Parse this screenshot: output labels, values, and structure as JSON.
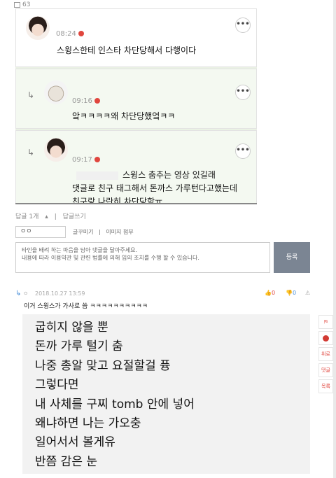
{
  "header": {
    "comment_count": "63"
  },
  "screenshot": {
    "comments": [
      {
        "time": "08:24",
        "text": "스윙스한테 인스타 차단당해서 다행이다",
        "reply": false
      },
      {
        "time": "09:16",
        "text": "앜ㅋㅋㅋㅋ왜 차단당했엌ㅋㅋ",
        "reply": true
      },
      {
        "time": "09:17",
        "text_line1": "스윙스 춤추는 영상 있길래",
        "text_line2": "댓글로 친구 태그해서 돈까스 가루턴다고했는데",
        "text_line3": "친구랑 나란히 차단당함ㅠ",
        "reply": true
      }
    ],
    "more_glyph": "•••"
  },
  "replybar": {
    "reply_count": "답글 1개",
    "write_reply": "답글쓰기"
  },
  "form": {
    "nickname": "ㅇㅇ",
    "links": [
      "글꾸미기",
      "이미지 첨부"
    ],
    "placeholder_line1": "타인을 배려 하는 마음을 담아 댓글을 달아주세요.",
    "placeholder_line2": "내용에 따라 이용약관 및 관련 법률에 의해 임의 조치를 수행 할 수 있습니다.",
    "submit_label": "등록"
  },
  "reply_comment": {
    "author": "ㅇ",
    "date": "2018.10.27 13:59",
    "upvotes": "0",
    "downvotes": "0",
    "text": "이거 스윙스가 가사로 씀 ㅋㅋㅋㅋㅋㅋㅋㅋㅋㅋ",
    "lyrics": [
      "굽히지 않을 뿐",
      "돈까 가루 털기 춤",
      "나중 총알 맞고 요절할걸 퓽",
      "그렇다면",
      "내 사체를 구찌 tomb 안에 넣어",
      "왜냐하면 나는 가오충",
      "일어서서 볼게유",
      "반쯤 감은 눈"
    ]
  },
  "sidebar": {
    "items": [
      "위로",
      "댓글",
      "목록"
    ]
  },
  "colors": {
    "accent_red": "#e0463e",
    "button_gray": "#7b8593",
    "link_blue": "#4a8fd8"
  }
}
